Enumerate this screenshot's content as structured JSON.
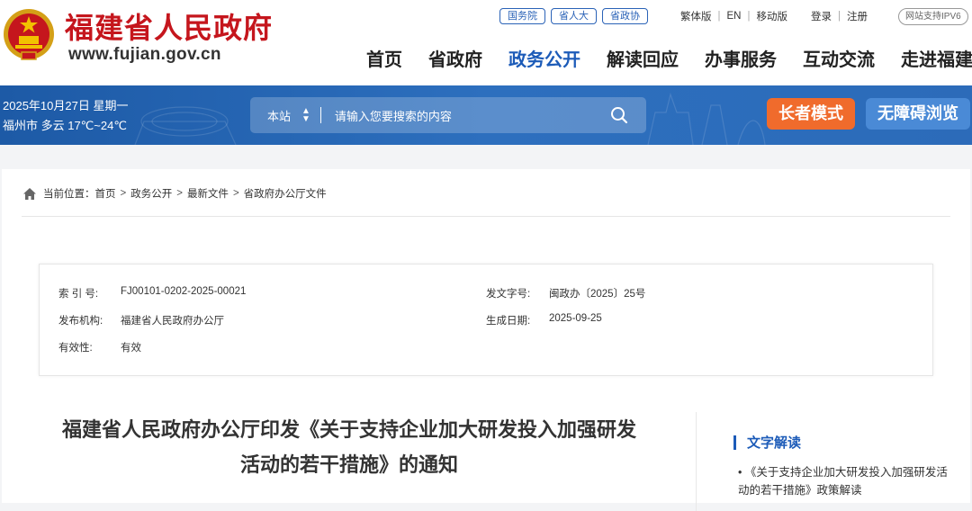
{
  "site": {
    "name": "福建省人民政府",
    "url": "www.fujian.gov.cn"
  },
  "top_links": [
    "国务院",
    "省人大",
    "省政协"
  ],
  "util_links": {
    "traditional": "繁体版",
    "english": "EN",
    "mobile": "移动版",
    "login": "登录",
    "register": "注册"
  },
  "ipv6_badge": "网站支持IPV6",
  "nav": [
    "首页",
    "省政府",
    "政务公开",
    "解读回应",
    "办事服务",
    "互动交流",
    "走进福建"
  ],
  "date_line": "2025年10月27日 星期一",
  "weather_line": "福州市 多云 17℃~24℃",
  "search": {
    "scope": "本站",
    "placeholder": "请输入您要搜索的内容"
  },
  "buttons": {
    "elder_mode": "长者模式",
    "accessible": "无障碍浏览"
  },
  "breadcrumb": {
    "prefix": "当前位置：",
    "items": [
      "首页",
      "政务公开",
      "最新文件",
      "省政府办公厅文件"
    ]
  },
  "meta": {
    "index_label": "索 引 号:",
    "index_value": "FJ00101-0202-2025-00021",
    "doc_no_label": "发文字号:",
    "doc_no_value": "闽政办〔2025〕25号",
    "issuer_label": "发布机构:",
    "issuer_value": "福建省人民政府办公厅",
    "date_label": "生成日期:",
    "date_value": "2025-09-25",
    "validity_label": "有效性:",
    "validity_value": "有效"
  },
  "article_title_line1": "福建省人民政府办公厅印发《关于支持企业加大研发投入加强研发",
  "article_title_line2": "活动的若干措施》的通知",
  "sidebar": {
    "heading": "文字解读",
    "item": "《关于支持企业加大研发投入加强研发活动的若干措施》政策解读"
  },
  "colors": {
    "brand_red": "#c5161d",
    "nav_blue": "#1c5bb8",
    "banner_blue": "#2d6fbe",
    "elder_orange": "#f06b2c",
    "access_blue": "#4a8ad6"
  }
}
